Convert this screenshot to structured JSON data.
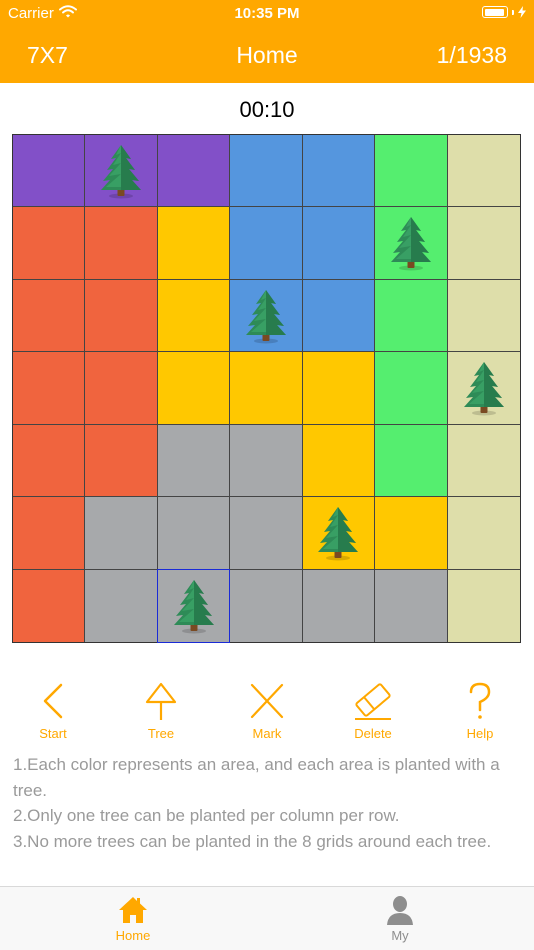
{
  "status_bar": {
    "carrier": "Carrier",
    "time": "10:35 PM"
  },
  "nav": {
    "size_label": "7X7",
    "title": "Home",
    "progress": "1/1938"
  },
  "timer": "00:10",
  "colors": {
    "accent": "#FFA800",
    "purple": "#8250C8",
    "blue": "#5596DE",
    "green": "#55EE6F",
    "khaki": "#DEDEAA",
    "red": "#F0643E",
    "yellow": "#FFC800",
    "gray": "#A7A9AB"
  },
  "board": {
    "size": 7,
    "regions": [
      [
        "purple",
        "purple",
        "purple",
        "blue",
        "blue",
        "green",
        "khaki"
      ],
      [
        "red",
        "red",
        "yellow",
        "blue",
        "blue",
        "green",
        "khaki"
      ],
      [
        "red",
        "red",
        "yellow",
        "blue",
        "blue",
        "green",
        "khaki"
      ],
      [
        "red",
        "red",
        "yellow",
        "yellow",
        "yellow",
        "green",
        "khaki"
      ],
      [
        "red",
        "red",
        "gray",
        "gray",
        "yellow",
        "green",
        "khaki"
      ],
      [
        "red",
        "gray",
        "gray",
        "gray",
        "yellow",
        "yellow",
        "khaki"
      ],
      [
        "red",
        "gray",
        "gray",
        "gray",
        "gray",
        "gray",
        "khaki"
      ]
    ],
    "trees": [
      [
        0,
        1
      ],
      [
        1,
        5
      ],
      [
        2,
        3
      ],
      [
        3,
        6
      ],
      [
        5,
        4
      ],
      [
        6,
        2
      ]
    ],
    "selected": [
      6,
      2
    ]
  },
  "toolbar": {
    "start": "Start",
    "tree": "Tree",
    "mark": "Mark",
    "delete": "Delete",
    "help": "Help"
  },
  "rules": {
    "r1": "1.Each color represents an area, and each area is planted with a tree.",
    "r2": "2.Only one tree can be planted per column per row.",
    "r3": "3.No more trees can be planted in the 8 grids around each tree."
  },
  "tabs": {
    "home": "Home",
    "my": "My"
  }
}
